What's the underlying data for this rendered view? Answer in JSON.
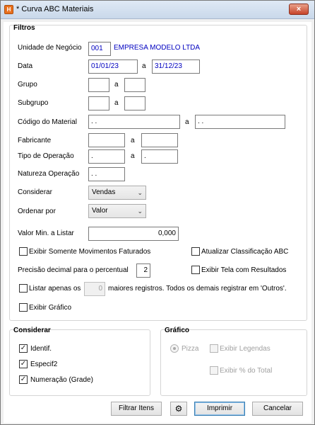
{
  "window": {
    "title": "* Curva ABC Materiais",
    "close_label": "×"
  },
  "filtros": {
    "title": "Filtros",
    "unidade_label": "Unidade de Negócio",
    "unidade_code": "001",
    "unidade_name": "EMPRESA MODELO LTDA",
    "data_label": "Data",
    "data_from": "01/01/23",
    "data_sep": "a",
    "data_to": "31/12/23",
    "grupo_label": "Grupo",
    "grupo_sep": "a",
    "subgrupo_label": "Subgrupo",
    "subgrupo_sep": "a",
    "codigo_label": "Código do Material",
    "codigo_from": " .  .",
    "codigo_sep": "a",
    "codigo_to": " .  .",
    "fabricante_label": "Fabricante",
    "fabricante_sep": "a",
    "tipo_op_label": "Tipo de Operação",
    "tipo_op_from": " .",
    "tipo_op_sep": "a",
    "tipo_op_to": " .",
    "natureza_label": "Natureza Operação",
    "natureza_value": " .  .",
    "considerar_label": "Considerar",
    "considerar_value": "Vendas",
    "ordenar_label": "Ordenar por",
    "ordenar_value": "Valor",
    "valor_min_label": "Valor Min. a Listar",
    "valor_min_value": "0,000",
    "exibir_faturados_label": "Exibir Somente Movimentos Faturados",
    "atualizar_abc_label": "Atualizar Classificação ABC",
    "precisao_label": "Precisão decimal para o percentual",
    "precisao_value": "2",
    "exibir_tela_label": "Exibir Tela com Resultados",
    "listar_label": "Listar apenas os",
    "listar_value": "0",
    "listar_suffix": "maiores registros. Todos os demais registrar em 'Outros'.",
    "exibir_grafico_label": "Exibir Gráfico"
  },
  "considerar_group": {
    "title": "Considerar",
    "items": [
      {
        "label": "Identif.",
        "checked": true
      },
      {
        "label": "Especif2",
        "checked": true
      },
      {
        "label": "Numeração (Grade)",
        "checked": true
      }
    ]
  },
  "grafico_group": {
    "title": "Gráfico",
    "pizza_label": "Pizza",
    "legendas_label": "Exibir Legendas",
    "perc_total_label": "Exibir % do Total"
  },
  "footer": {
    "filtrar_label": "Filtrar Itens",
    "settings_icon": "gear-icon",
    "imprimir_label": "Imprimir",
    "cancelar_label": "Cancelar"
  },
  "colors": {
    "blue_text": "#0000c0"
  }
}
